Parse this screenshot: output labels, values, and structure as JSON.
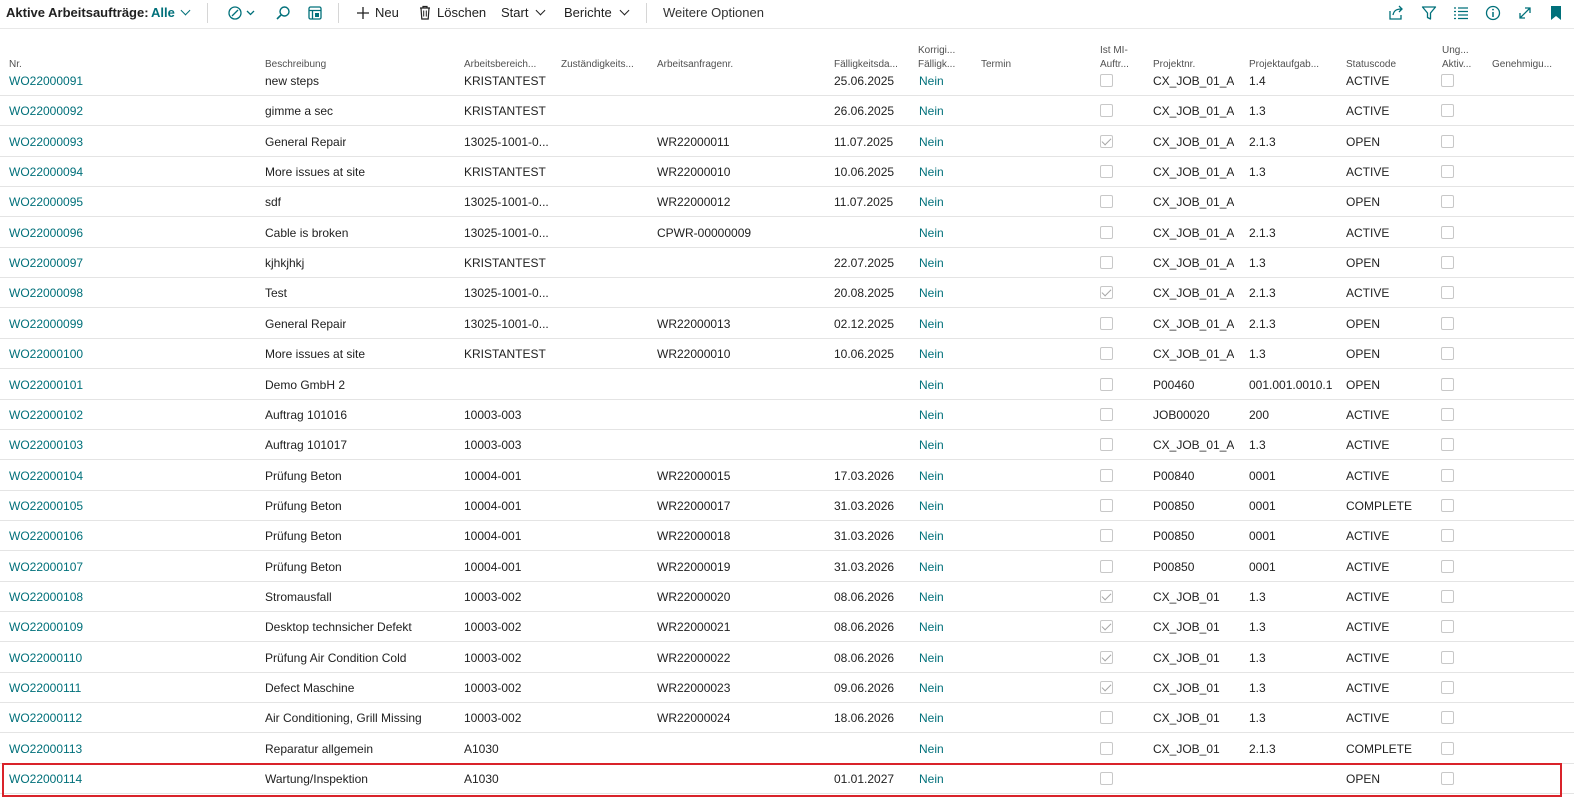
{
  "toolbar": {
    "title": "Aktive Arbeitsaufträge:",
    "filter_label": "Alle",
    "new_label": "Neu",
    "delete_label": "Löschen",
    "start_label": "Start",
    "reports_label": "Berichte",
    "more_label": "Weitere Optionen",
    "icons": [
      "analyze-icon",
      "search-icon",
      "edit-list-icon",
      "share-icon",
      "filter-icon",
      "list-view-icon",
      "info-icon",
      "expand-icon",
      "bookmark-icon"
    ]
  },
  "columns": {
    "nr": "Nr.",
    "beschreibung": "Beschreibung",
    "arbeitsbereich": "Arbeitsbereich...",
    "zustaendigkeit": "Zuständigkeits...",
    "arbeitsanfragenr": "Arbeitsanfragenr.",
    "faelligkeit": "Fälligkeitsda...",
    "korrig_1": "Korrigi...",
    "korrig_2": "Fälligk...",
    "termin": "Termin",
    "ist_mi_1": "Ist MI-",
    "ist_mi_2": "Auftr...",
    "projektnr": "Projektnr.",
    "projektaufgabe": "Projektaufgab...",
    "statuscode": "Statuscode",
    "ung_1": "Ung...",
    "ung_2": "Aktiv...",
    "genehmigung": "Genehmigu..."
  },
  "rows": [
    {
      "nr": "WO22000091",
      "desc": "new steps",
      "area": "KRISTANTEST",
      "req": "",
      "due": "25.06.2025",
      "korr": "Nein",
      "mi": false,
      "proj": "CX_JOB_01_A",
      "task": "1.4",
      "status": "ACTIVE"
    },
    {
      "nr": "WO22000092",
      "desc": "gimme a sec",
      "area": "KRISTANTEST",
      "req": "",
      "due": "26.06.2025",
      "korr": "Nein",
      "mi": false,
      "proj": "CX_JOB_01_A",
      "task": "1.3",
      "status": "ACTIVE"
    },
    {
      "nr": "WO22000093",
      "desc": "General Repair",
      "area": "13025-1001-0...",
      "req": "WR22000011",
      "due": "11.07.2025",
      "korr": "Nein",
      "mi": true,
      "proj": "CX_JOB_01_A",
      "task": "2.1.3",
      "status": "OPEN"
    },
    {
      "nr": "WO22000094",
      "desc": "More issues at site",
      "area": "KRISTANTEST",
      "req": "WR22000010",
      "due": "10.06.2025",
      "korr": "Nein",
      "mi": false,
      "proj": "CX_JOB_01_A",
      "task": "1.3",
      "status": "ACTIVE"
    },
    {
      "nr": "WO22000095",
      "desc": "sdf",
      "area": "13025-1001-0...",
      "req": "WR22000012",
      "due": "11.07.2025",
      "korr": "Nein",
      "mi": false,
      "proj": "CX_JOB_01_A",
      "task": "",
      "status": "OPEN"
    },
    {
      "nr": "WO22000096",
      "desc": "Cable is broken",
      "area": "13025-1001-0...",
      "req": "CPWR-00000009",
      "due": "",
      "korr": "Nein",
      "mi": false,
      "proj": "CX_JOB_01_A",
      "task": "2.1.3",
      "status": "ACTIVE"
    },
    {
      "nr": "WO22000097",
      "desc": "kjhkjhkj",
      "area": "KRISTANTEST",
      "req": "",
      "due": "22.07.2025",
      "korr": "Nein",
      "mi": false,
      "proj": "CX_JOB_01_A",
      "task": "1.3",
      "status": "OPEN"
    },
    {
      "nr": "WO22000098",
      "desc": "Test",
      "area": "13025-1001-0...",
      "req": "",
      "due": "20.08.2025",
      "korr": "Nein",
      "mi": true,
      "proj": "CX_JOB_01_A",
      "task": "2.1.3",
      "status": "ACTIVE"
    },
    {
      "nr": "WO22000099",
      "desc": "General Repair",
      "area": "13025-1001-0...",
      "req": "WR22000013",
      "due": "02.12.2025",
      "korr": "Nein",
      "mi": false,
      "proj": "CX_JOB_01_A",
      "task": "2.1.3",
      "status": "OPEN"
    },
    {
      "nr": "WO22000100",
      "desc": "More issues at site",
      "area": "KRISTANTEST",
      "req": "WR22000010",
      "due": "10.06.2025",
      "korr": "Nein",
      "mi": false,
      "proj": "CX_JOB_01_A",
      "task": "1.3",
      "status": "OPEN"
    },
    {
      "nr": "WO22000101",
      "desc": "Demo GmbH 2",
      "area": "",
      "req": "",
      "due": "",
      "korr": "Nein",
      "mi": false,
      "proj": "P00460",
      "task": "001.001.0010.1",
      "status": "OPEN"
    },
    {
      "nr": "WO22000102",
      "desc": "Auftrag 101016",
      "area": "10003-003",
      "req": "",
      "due": "",
      "korr": "Nein",
      "mi": false,
      "proj": "JOB00020",
      "task": "200",
      "status": "ACTIVE"
    },
    {
      "nr": "WO22000103",
      "desc": "Auftrag 101017",
      "area": "10003-003",
      "req": "",
      "due": "",
      "korr": "Nein",
      "mi": false,
      "proj": "CX_JOB_01_A",
      "task": "1.3",
      "status": "ACTIVE"
    },
    {
      "nr": "WO22000104",
      "desc": "Prüfung Beton",
      "area": "10004-001",
      "req": "WR22000015",
      "due": "17.03.2026",
      "korr": "Nein",
      "mi": false,
      "proj": "P00840",
      "task": "0001",
      "status": "ACTIVE"
    },
    {
      "nr": "WO22000105",
      "desc": "Prüfung Beton",
      "area": "10004-001",
      "req": "WR22000017",
      "due": "31.03.2026",
      "korr": "Nein",
      "mi": false,
      "proj": "P00850",
      "task": "0001",
      "status": "COMPLETE"
    },
    {
      "nr": "WO22000106",
      "desc": "Prüfung Beton",
      "area": "10004-001",
      "req": "WR22000018",
      "due": "31.03.2026",
      "korr": "Nein",
      "mi": false,
      "proj": "P00850",
      "task": "0001",
      "status": "ACTIVE"
    },
    {
      "nr": "WO22000107",
      "desc": "Prüfung Beton",
      "area": "10004-001",
      "req": "WR22000019",
      "due": "31.03.2026",
      "korr": "Nein",
      "mi": false,
      "proj": "P00850",
      "task": "0001",
      "status": "ACTIVE"
    },
    {
      "nr": "WO22000108",
      "desc": "Stromausfall",
      "area": "10003-002",
      "req": "WR22000020",
      "due": "08.06.2026",
      "korr": "Nein",
      "mi": true,
      "proj": "CX_JOB_01",
      "task": "1.3",
      "status": "ACTIVE"
    },
    {
      "nr": "WO22000109",
      "desc": "Desktop technsicher Defekt",
      "area": "10003-002",
      "req": "WR22000021",
      "due": "08.06.2026",
      "korr": "Nein",
      "mi": true,
      "proj": "CX_JOB_01",
      "task": "1.3",
      "status": "ACTIVE"
    },
    {
      "nr": "WO22000110",
      "desc": "Prüfung Air Condition Cold",
      "area": "10003-002",
      "req": "WR22000022",
      "due": "08.06.2026",
      "korr": "Nein",
      "mi": true,
      "proj": "CX_JOB_01",
      "task": "1.3",
      "status": "ACTIVE"
    },
    {
      "nr": "WO22000111",
      "desc": "Defect Maschine",
      "area": "10003-002",
      "req": "WR22000023",
      "due": "09.06.2026",
      "korr": "Nein",
      "mi": true,
      "proj": "CX_JOB_01",
      "task": "1.3",
      "status": "ACTIVE"
    },
    {
      "nr": "WO22000112",
      "desc": "Air Conditioning, Grill Missing",
      "area": "10003-002",
      "req": "WR22000024",
      "due": "18.06.2026",
      "korr": "Nein",
      "mi": false,
      "proj": "CX_JOB_01",
      "task": "1.3",
      "status": "ACTIVE"
    },
    {
      "nr": "WO22000113",
      "desc": "Reparatur allgemein",
      "area": "A1030",
      "req": "",
      "due": "",
      "korr": "Nein",
      "mi": false,
      "proj": "CX_JOB_01",
      "task": "2.1.3",
      "status": "COMPLETE"
    },
    {
      "nr": "WO22000114",
      "desc": "Wartung/Inspektion",
      "area": "A1030",
      "req": "",
      "due": "01.01.2027",
      "korr": "Nein",
      "mi": false,
      "proj": "",
      "task": "",
      "status": "OPEN"
    }
  ]
}
